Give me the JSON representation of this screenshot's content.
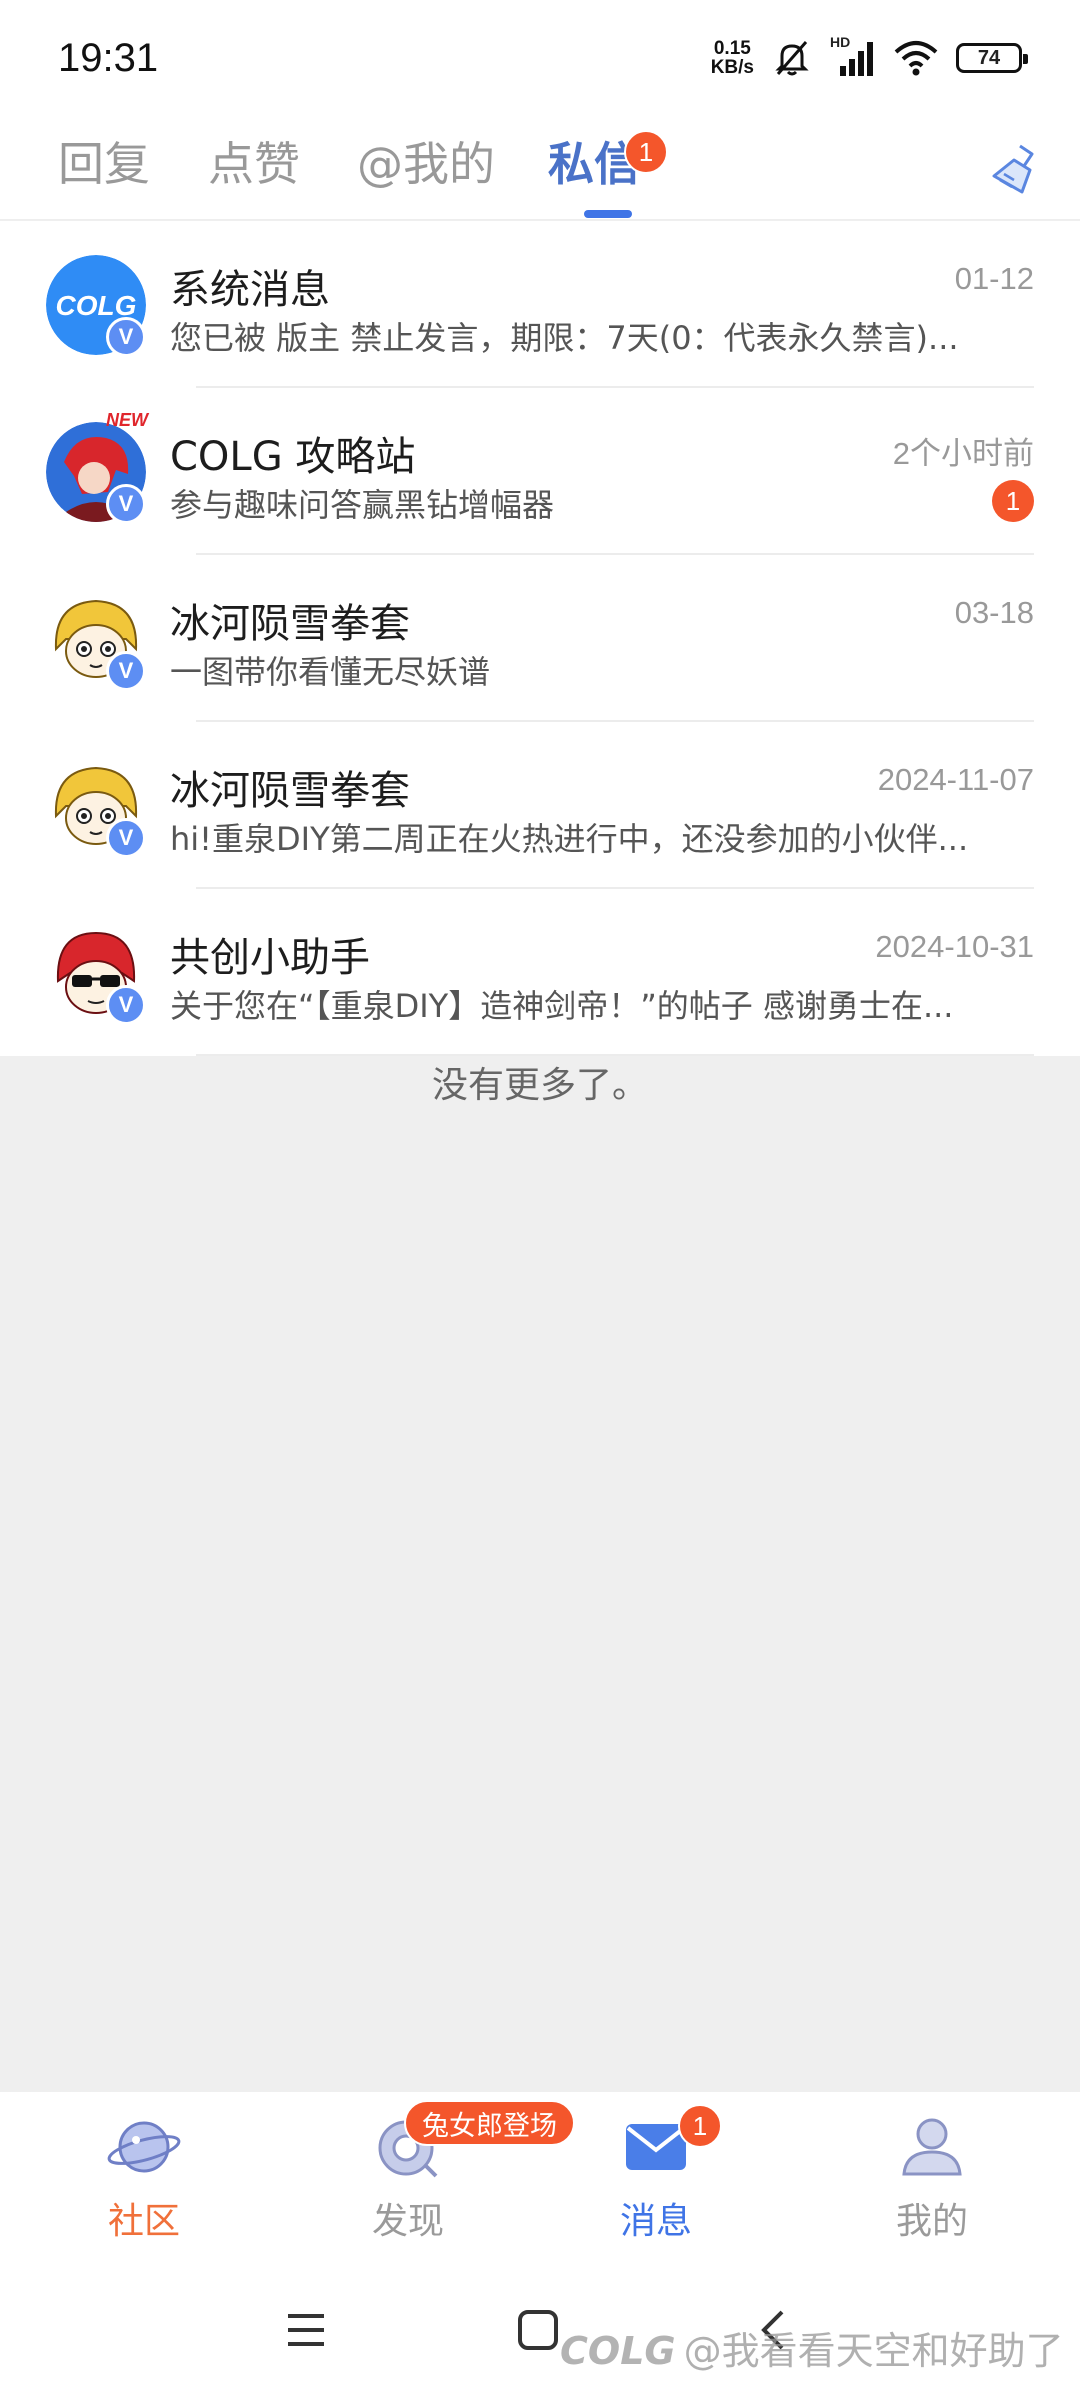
{
  "status_bar": {
    "time": "19:31",
    "net_speed_value": "0.15",
    "net_speed_unit": "KB/s",
    "network_type": "HD",
    "battery": "74",
    "icons": [
      "mute-bell-icon",
      "signal-icon",
      "wifi-icon",
      "battery-icon"
    ]
  },
  "tabs": {
    "items": [
      {
        "label": "回复"
      },
      {
        "label": "点赞"
      },
      {
        "label": "@我的"
      },
      {
        "label": "私信"
      }
    ],
    "active_index": 3,
    "badge": "1",
    "clear_icon": "broom-icon"
  },
  "messages": [
    {
      "name": "系统消息",
      "time": "01-12",
      "preview": "您已被 版主 禁止发言，期限：7天(0：代表永久禁言)...",
      "avatar": "colg-logo",
      "unread": ""
    },
    {
      "name": "COLG 攻略站",
      "time": "2个小时前",
      "preview": "参与趣味问答赢黑钻增幅器",
      "avatar": "red-hair-character",
      "unread": "1"
    },
    {
      "name": "冰河陨雪拳套",
      "time": "03-18",
      "preview": "一图带你看懂无尽妖谱",
      "avatar": "blonde-cartoon-girl",
      "unread": ""
    },
    {
      "name": "冰河陨雪拳套",
      "time": "2024-11-07",
      "preview": "hi!重泉DIY第二周正在火热进行中，还没参加的小伙伴...",
      "avatar": "blonde-cartoon-girl",
      "unread": ""
    },
    {
      "name": "共创小助手",
      "time": "2024-10-31",
      "preview": "关于您在“【重泉DIY】造神剑帝！”的帖子 感谢勇士在...",
      "avatar": "sunglasses-character",
      "unread": ""
    }
  ],
  "list_footer": "没有更多了。",
  "bottom_nav": {
    "items": [
      {
        "label": "社区",
        "icon": "planet-icon"
      },
      {
        "label": "发现",
        "icon": "discover-icon"
      },
      {
        "label": "消息",
        "icon": "mail-icon"
      },
      {
        "label": "我的",
        "icon": "profile-icon"
      }
    ],
    "active_index": 2,
    "promo_tag": "兔女郎登场",
    "message_badge": "1"
  },
  "system_nav": {
    "buttons": [
      "menu-icon",
      "home-icon",
      "back-icon"
    ]
  },
  "watermark": {
    "logo": "COLG",
    "text": "@我看看天空和好助了"
  },
  "colors": {
    "accent_blue": "#3f74e6",
    "accent_orange": "#f0703a",
    "badge_red": "#f4562b"
  }
}
